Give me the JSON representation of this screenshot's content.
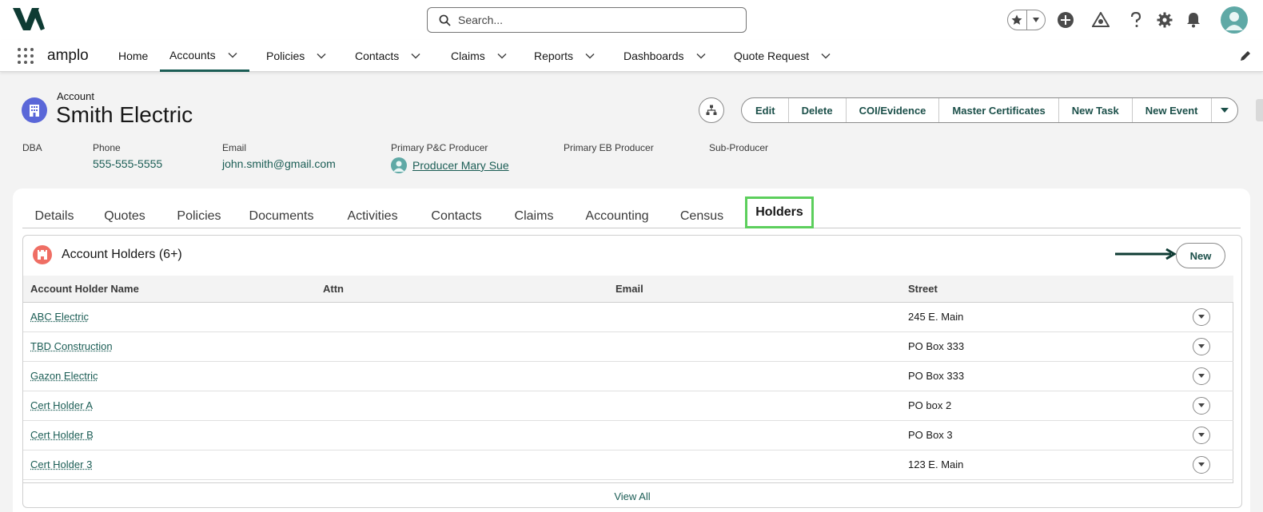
{
  "header": {
    "search_placeholder": "Search...",
    "colors": {
      "brand": "#0e3b33",
      "accent": "#1b5d55",
      "highlight_box": "#5ccf5c"
    }
  },
  "nav": {
    "app_name": "amplo",
    "items": [
      {
        "label": "Home",
        "has_menu": false,
        "active": false
      },
      {
        "label": "Accounts",
        "has_menu": true,
        "active": true
      },
      {
        "label": "Policies",
        "has_menu": true,
        "active": false
      },
      {
        "label": "Contacts",
        "has_menu": true,
        "active": false
      },
      {
        "label": "Claims",
        "has_menu": true,
        "active": false
      },
      {
        "label": "Reports",
        "has_menu": true,
        "active": false
      },
      {
        "label": "Dashboards",
        "has_menu": true,
        "active": false
      },
      {
        "label": "Quote Request",
        "has_menu": true,
        "active": false
      }
    ]
  },
  "account": {
    "type_label": "Account",
    "name": "Smith Electric",
    "actions": [
      "Edit",
      "Delete",
      "COI/Evidence",
      "Master Certificates",
      "New Task",
      "New Event"
    ],
    "fields": {
      "dba_label": "DBA",
      "phone_label": "Phone",
      "phone": "555-555-5555",
      "email_label": "Email",
      "email": "john.smith@gmail.com",
      "primary_pc_label": "Primary P&C Producer",
      "primary_pc": "Producer Mary Sue",
      "primary_eb_label": "Primary EB Producer",
      "sub_producer_label": "Sub-Producer"
    }
  },
  "tabs": [
    "Details",
    "Quotes",
    "Policies",
    "Documents",
    "Activities",
    "Contacts",
    "Claims",
    "Accounting",
    "Census",
    "Holders"
  ],
  "active_tab": "Holders",
  "holders": {
    "title": "Account Holders (6+)",
    "new_label": "New",
    "columns": [
      "Account Holder Name",
      "Attn",
      "Email",
      "Street"
    ],
    "rows": [
      {
        "name": "ABC Electric",
        "attn": "",
        "email": "",
        "street": "245 E. Main"
      },
      {
        "name": "TBD Construction",
        "attn": "",
        "email": "",
        "street": "PO Box 333"
      },
      {
        "name": "Gazon Electric",
        "attn": "",
        "email": "",
        "street": "PO Box 333"
      },
      {
        "name": "Cert Holder A",
        "attn": "",
        "email": "",
        "street": "PO box 2"
      },
      {
        "name": "Cert Holder B",
        "attn": "",
        "email": "",
        "street": "PO Box 3"
      },
      {
        "name": "Cert Holder 3",
        "attn": "",
        "email": "",
        "street": "123 E. Main"
      }
    ],
    "view_all": "View All"
  }
}
